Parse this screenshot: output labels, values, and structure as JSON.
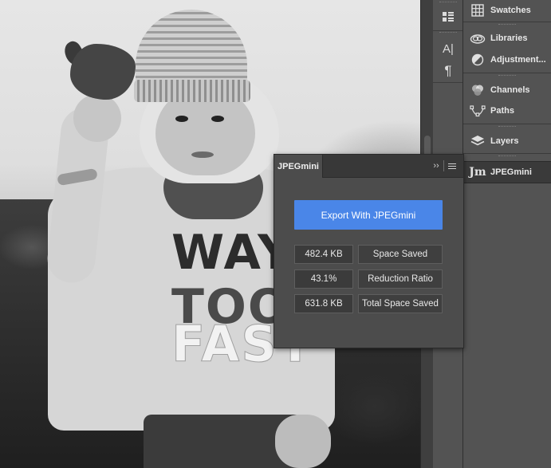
{
  "dock": {
    "items": [
      {
        "label": "Swatches",
        "icon": "grid-icon"
      },
      {
        "label": "Libraries",
        "icon": "cloud-icon"
      },
      {
        "label": "Adjustment...",
        "icon": "half-circle-icon"
      },
      {
        "label": "Channels",
        "icon": "channels-icon"
      },
      {
        "label": "Paths",
        "icon": "pen-path-icon"
      },
      {
        "label": "Layers",
        "icon": "layers-icon"
      },
      {
        "label": "JPEGmini",
        "icon": "jm-logo",
        "icon_text": "Jm"
      }
    ]
  },
  "iconcol": {
    "items": [
      {
        "name": "properties-icon",
        "glyph": "▦"
      },
      {
        "name": "character-icon",
        "glyph": "A|"
      },
      {
        "name": "paragraph-icon",
        "glyph": "¶"
      }
    ]
  },
  "jpegmini": {
    "tab_label": "JPEGmini",
    "collapse_glyph": "››",
    "export_label": "Export With JPEGmini",
    "stats": [
      {
        "value": "482.4 KB",
        "label": "Space Saved"
      },
      {
        "value": "43.1%",
        "label": "Reduction Ratio"
      },
      {
        "value": "631.8 KB",
        "label": "Total Space Saved"
      }
    ]
  },
  "canvas": {
    "shirt_lines": [
      "WAY",
      "TOO",
      "FAST"
    ]
  },
  "colors": {
    "accent": "#4a86e8",
    "panel": "#535353",
    "panel_dark": "#383838"
  }
}
